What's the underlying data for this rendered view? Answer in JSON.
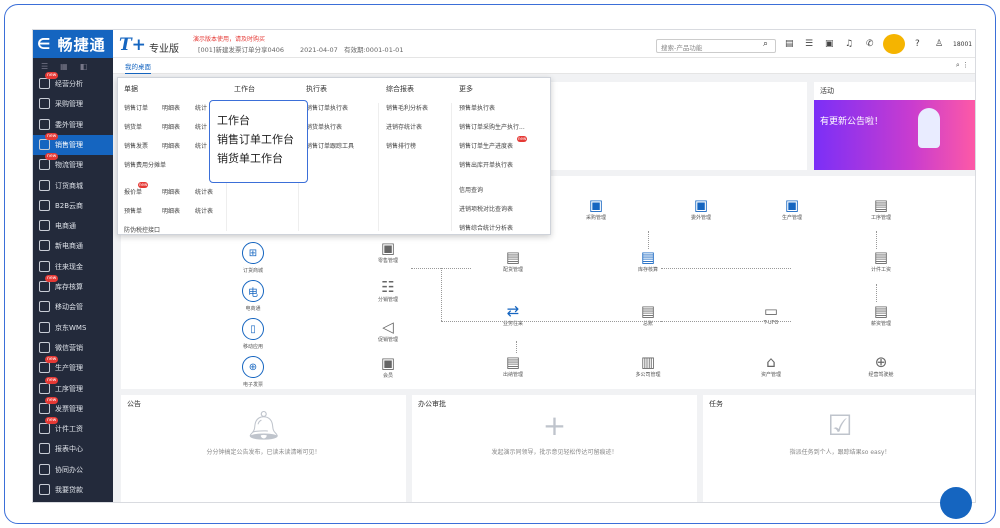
{
  "brand": {
    "name": "畅捷通",
    "logo": "T+",
    "edition": "专业版",
    "demo_notice": "演示版本使用，请及时购买",
    "company": "[001]新建发票订单分享0406",
    "date": "2021-04-07",
    "valid_period": "有效期:0001-01-01"
  },
  "search": {
    "placeholder": "搜索-产品功能"
  },
  "user": {
    "label": "18001"
  },
  "sidebar": {
    "items": [
      {
        "label": "经营分析",
        "new": "new"
      },
      {
        "label": "采购管理"
      },
      {
        "label": "委外管理"
      },
      {
        "label": "销售管理",
        "new": "new",
        "active": true
      },
      {
        "label": "物流管理",
        "new": "new"
      },
      {
        "label": "订货商城"
      },
      {
        "label": "B2B云商"
      },
      {
        "label": "电商通"
      },
      {
        "label": "新电商通"
      },
      {
        "label": "往来现金"
      },
      {
        "label": "库存核算",
        "new": "new"
      },
      {
        "label": "移动会管"
      },
      {
        "label": "京东WMS"
      },
      {
        "label": "微信营销"
      },
      {
        "label": "生产管理",
        "new": "new"
      },
      {
        "label": "工序管理",
        "new": "new"
      },
      {
        "label": "发票管理",
        "new": "new"
      },
      {
        "label": "计件工资",
        "new": "new"
      },
      {
        "label": "报表中心"
      },
      {
        "label": "协同办公"
      },
      {
        "label": "我要贷款"
      }
    ]
  },
  "tabs": {
    "my_desktop": "我的桌面"
  },
  "activity": {
    "title": "活动",
    "banner": "有更新公告啦！"
  },
  "dropdown": {
    "col1": {
      "head": "单据",
      "rows": [
        [
          "销售订单",
          "明细表",
          "统计"
        ],
        [
          "销货单",
          "明细表",
          "统计"
        ],
        [
          "销售发票",
          "明细表",
          "统计"
        ]
      ],
      "extra": "销售费用分摊单",
      "rows2": [
        [
          "报价单",
          "明细表",
          "统计表"
        ],
        [
          "预售单",
          "明细表",
          "统计表"
        ]
      ],
      "extra2": "防伪税控接口",
      "new_label": "new"
    },
    "col2": {
      "head": "工作台"
    },
    "col3": {
      "head": "执行表",
      "items": [
        "销售订单执行表",
        "销货单执行表",
        "销售订单跟踪工具"
      ]
    },
    "col4": {
      "head": "综合报表",
      "items": [
        "销售毛利分析表",
        "进销存统计表",
        "销售排行榜"
      ]
    },
    "col5": {
      "head": "更多",
      "items": [
        "预售单执行表",
        "销售订单采购生产执行...",
        "销售订单生产进度表",
        "销售出库开单执行表",
        "信用查询",
        "进销项税对比查询表",
        "销售综合统计分析表"
      ],
      "new_label": "new"
    }
  },
  "tooltip": {
    "items": [
      "工作台",
      "销售订单工作台",
      "销货单工作台"
    ]
  },
  "flow": {
    "nodes": [
      "采购管理",
      "委外管理",
      "生产管理",
      "工序管理",
      "零售管理",
      "分销管理",
      "促销管理",
      "会员",
      "配货管理",
      "库存核算",
      "计件工资",
      "业务往来",
      "总账",
      "T-UFO",
      "薪资管理",
      "出纳管理",
      "多公司管理",
      "资产管理",
      "经营驾驶舱"
    ],
    "circles": [
      "订货商城",
      "电商通",
      "移动应用",
      "电子发票"
    ]
  },
  "cards": {
    "notice": {
      "title": "公告",
      "msg": "分分钟搞定公告发布，已读未读清晰可见！"
    },
    "approval": {
      "title": "办公审批",
      "msg": "发起演示同领导，批示意见轻松传达可留痕迹！"
    },
    "tasks": {
      "title": "任务",
      "msg": "指派任务到个人，跟踪结果so easy！"
    }
  }
}
